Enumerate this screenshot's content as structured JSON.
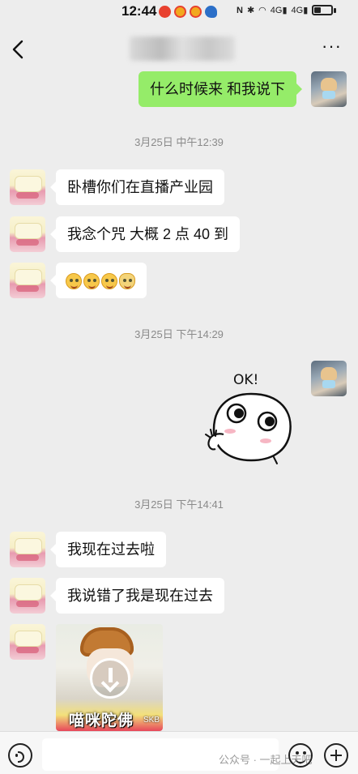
{
  "status_bar": {
    "time": "12:44",
    "app_icons": [
      {
        "name": "app-notification-icon-1",
        "color": "#e8412f"
      },
      {
        "name": "weibo-icon",
        "color": "#e8412f"
      },
      {
        "name": "weibo-icon-2",
        "color": "#e8412f"
      },
      {
        "name": "bird-app-icon",
        "color": "#2b6fc8"
      }
    ],
    "network_label_1": "4G",
    "network_label_2": "4G"
  },
  "header": {
    "more_label": "···"
  },
  "messages": {
    "m1_text": "什么时候来 和我说下",
    "ts1": "3月25日 中午12:39",
    "m2_text": "卧槽你们在直播产业园",
    "m3_text": "我念个咒 大概 2 点 40 到",
    "ts2": "3月25日 下午14:29",
    "sticker_text": "OK!",
    "ts3": "3月25日 下午14:41",
    "m5_text": "我现在过去啦",
    "m6_text": "我说错了我是现在过去",
    "image_caption": "喵咪陀佛",
    "image_mark": "SKB"
  },
  "input_bar": {
    "watermark_text": "公众号 · 一起上天吧"
  },
  "colors": {
    "background": "#ededed",
    "bubble_mine": "#95ec69",
    "bubble_theirs": "#ffffff"
  }
}
